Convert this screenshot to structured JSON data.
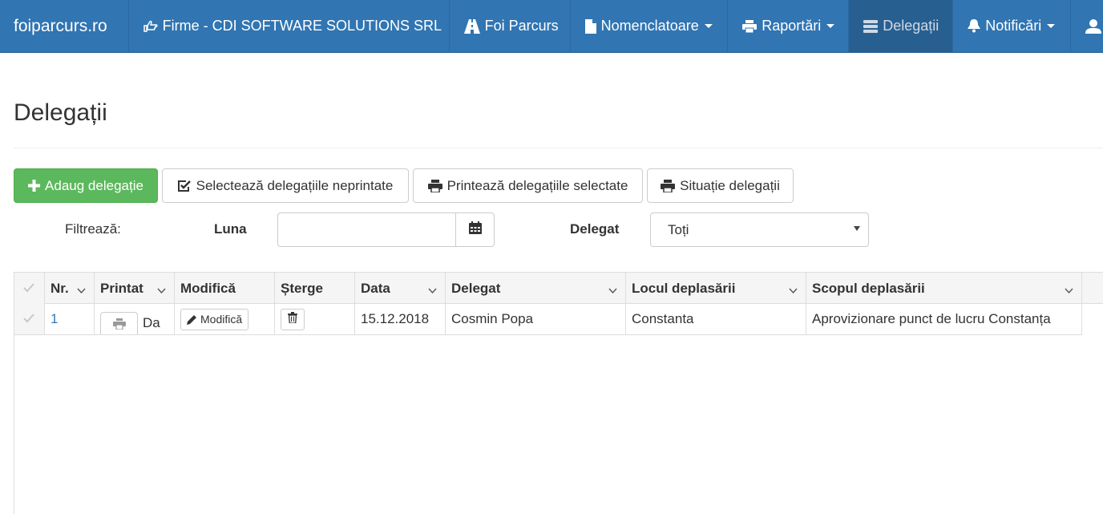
{
  "navbar": {
    "brand": "foiparcurs.ro",
    "firme": {
      "label": "Firme - CDI SOFTWARE SOLUTIONS SRL",
      "icon": "hand-point-right-icon"
    },
    "foi_parcurs": {
      "label": "Foi Parcurs",
      "icon": "road-icon"
    },
    "nomenclatoare": {
      "label": "Nomenclatoare",
      "icon": "file-icon"
    },
    "rapoarte": {
      "label": "Raportări",
      "icon": "print-icon"
    },
    "delegatii": {
      "label": "Delegații",
      "icon": "tasks-icon",
      "active": true
    },
    "notificari": {
      "label": "Notificări",
      "icon": "bell-icon"
    },
    "user": {
      "icon": "user-icon"
    }
  },
  "page": {
    "title": "Delegații"
  },
  "toolbar": {
    "add_label": "Adaug delegație",
    "select_label": "Selectează delegațiile neprintate",
    "print_label": "Printează delegațiile selectate",
    "situatie_label": "Situație delegații"
  },
  "filters": {
    "label": "Filtrează:",
    "luna_label": "Luna",
    "luna_value": "",
    "delegat_label": "Delegat",
    "delegat_selected": "Toți"
  },
  "grid": {
    "columns": {
      "nr": "Nr.",
      "printat": "Printat",
      "modifica": "Modifică",
      "sterge": "Șterge",
      "data": "Data",
      "delegat": "Delegat",
      "locul": "Locul deplasării",
      "scopul": "Scopul deplasării"
    },
    "rows": [
      {
        "nr": "1",
        "printat": "Da",
        "modifica_label": "Modifică",
        "data": "15.12.2018",
        "delegat": "Cosmin Popa",
        "locul": "Constanta",
        "scopul": "Aprovizionare punct de lucru Constanța"
      }
    ]
  },
  "colors": {
    "navbar": "#3175b2",
    "navbar_active": "#285f91",
    "success": "#5cb85c",
    "link": "#337ab7"
  }
}
